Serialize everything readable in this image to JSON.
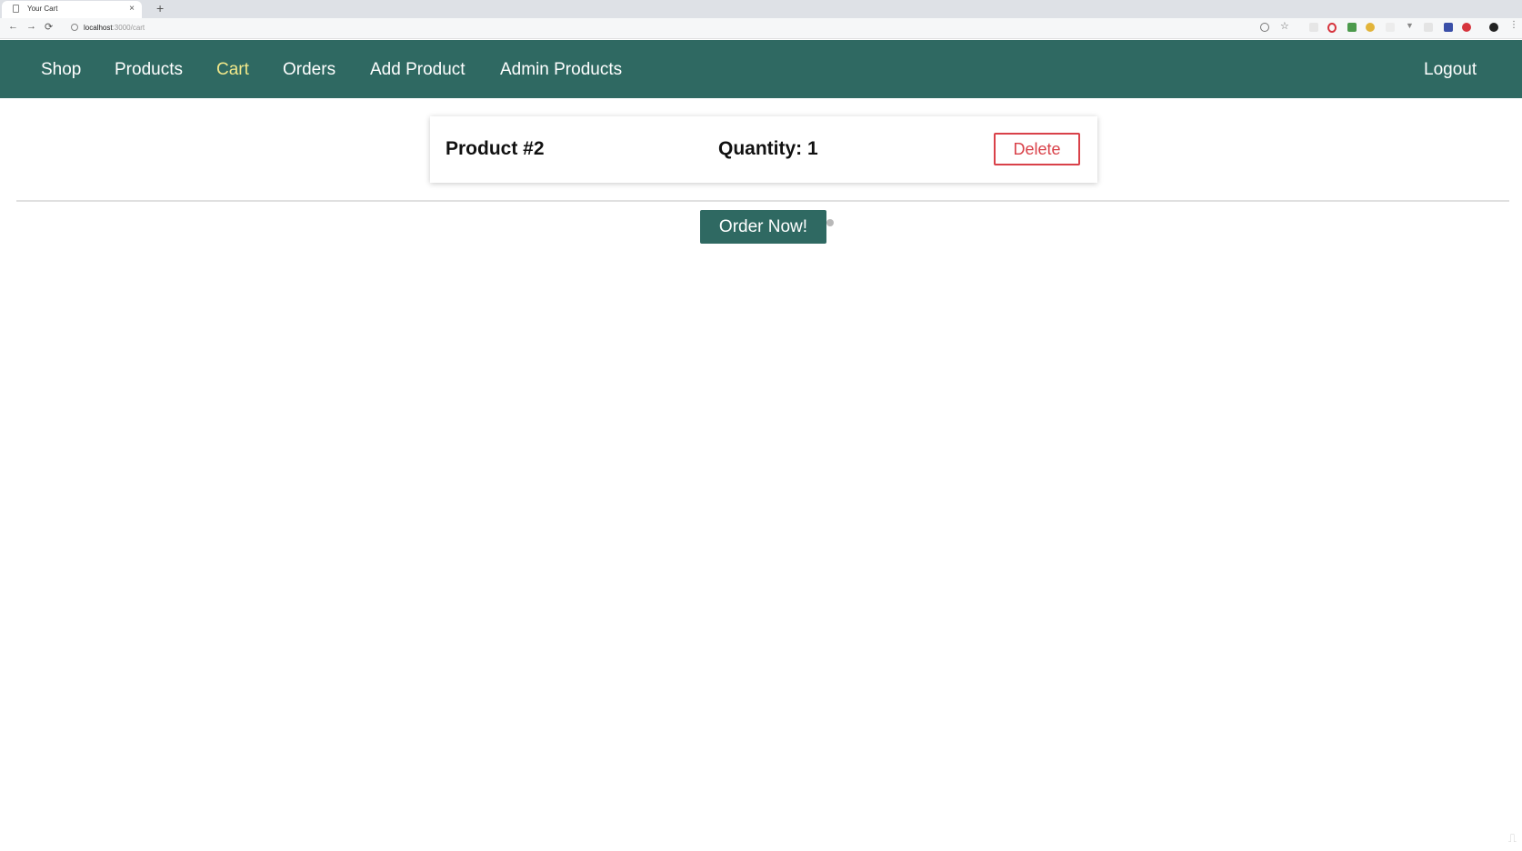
{
  "browser": {
    "tab_title": "Your Cart",
    "url_host": "localhost",
    "url_path": ":3000/cart",
    "back_icon": "←",
    "forward_icon": "→",
    "reload_icon": "⟳",
    "close_icon": "×",
    "newtab_icon": "+"
  },
  "nav": {
    "items": [
      "Shop",
      "Products",
      "Cart",
      "Orders",
      "Add Product",
      "Admin Products"
    ],
    "active": "Cart",
    "logout": "Logout"
  },
  "cart": {
    "items": [
      {
        "title": "Product #2",
        "quantity_label": "Quantity: 1",
        "delete_label": "Delete"
      }
    ],
    "order_button": "Order Now!"
  },
  "colors": {
    "header_bg": "#2f6962",
    "active_nav": "#f1e88a",
    "delete": "#d94149"
  },
  "watermark": "udemy"
}
